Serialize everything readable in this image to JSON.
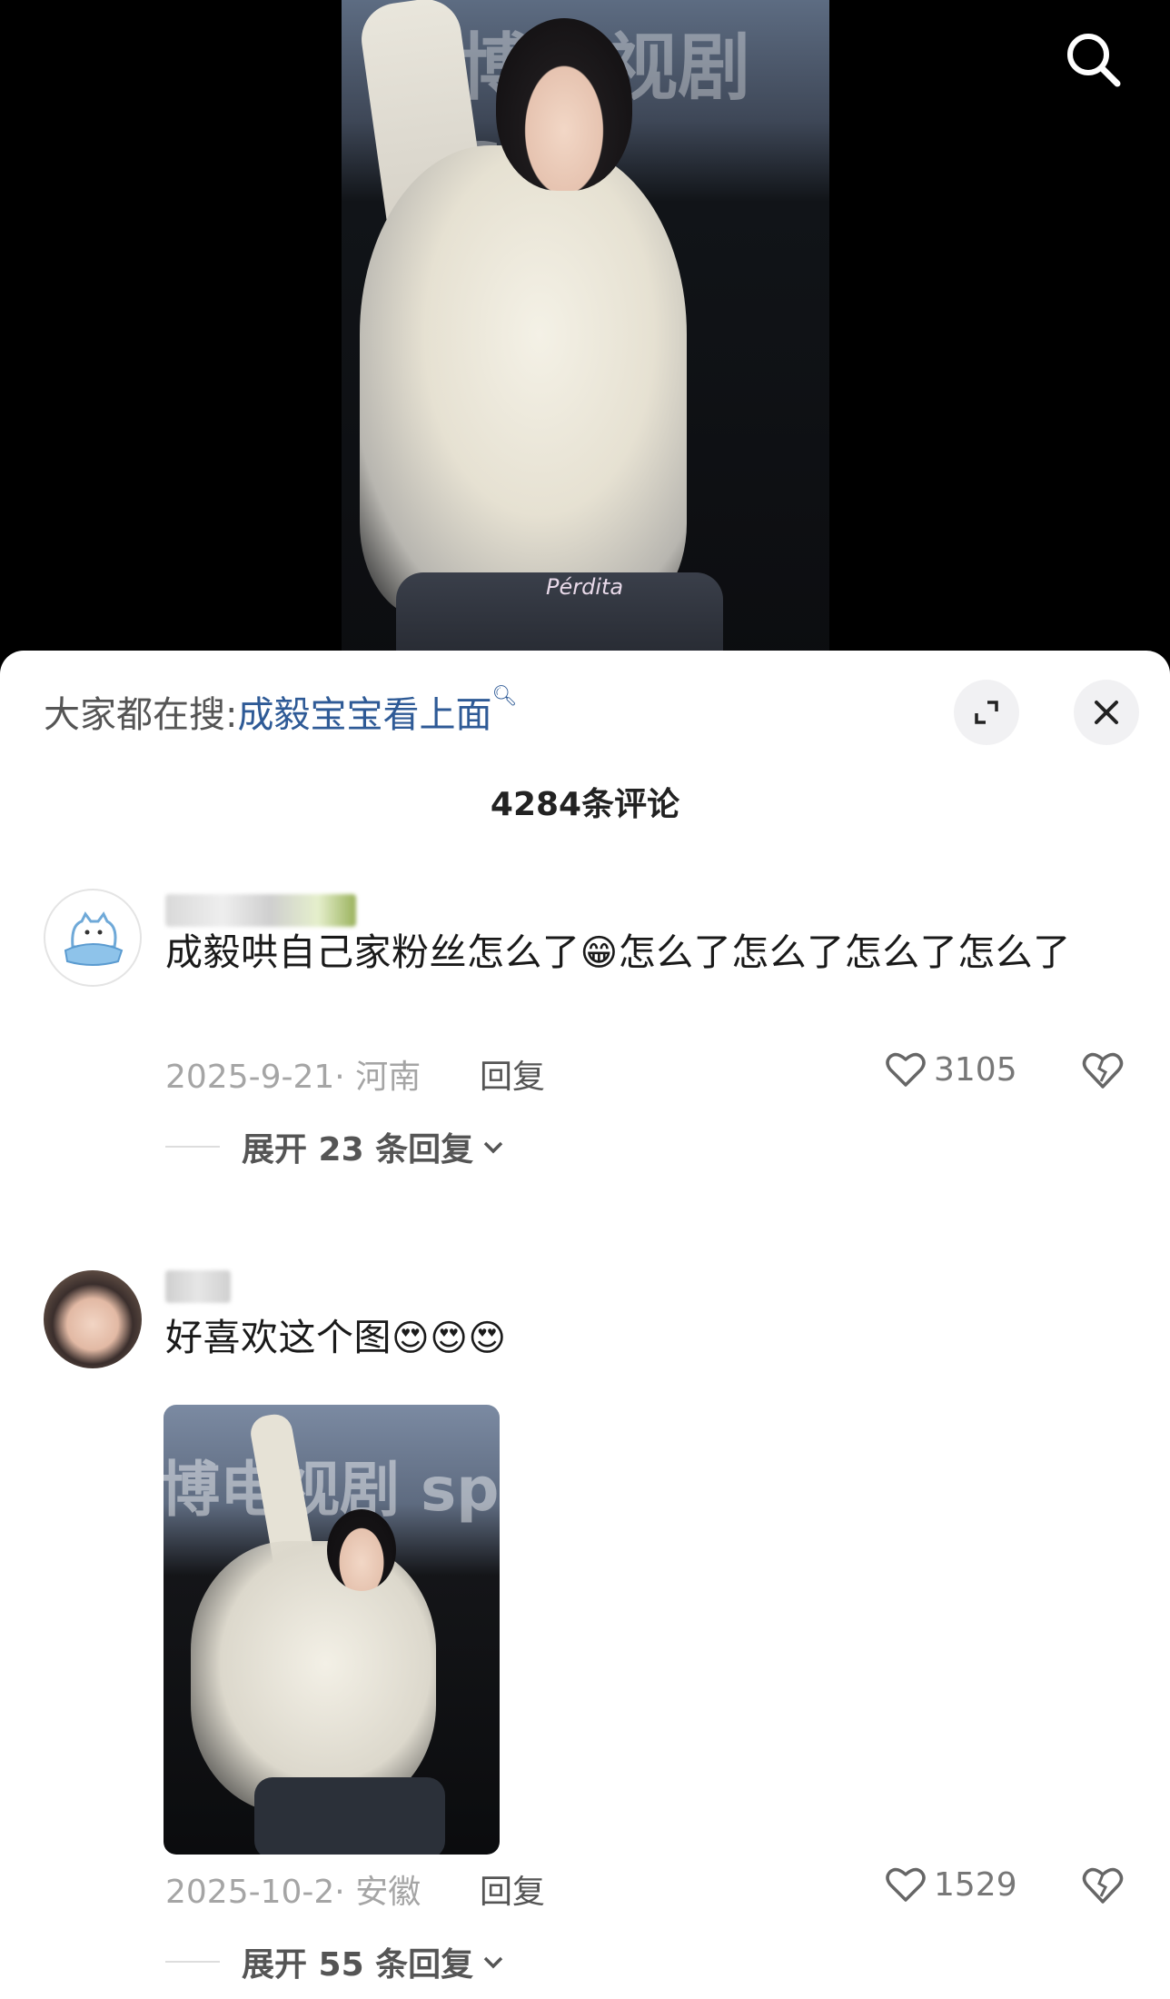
{
  "video": {
    "banner_text": "博电视剧 sp",
    "watermark": "Pérdita"
  },
  "header": {
    "search_prefix": "大家都在搜:",
    "search_keyword": "成毅宝宝看上面",
    "search_keyword_icon": "search-small-icon"
  },
  "comments_count_title": "4284条评论",
  "comments": [
    {
      "text_before_emoji": "成毅哄自己家粉丝怎么了",
      "emoji": "😁",
      "text_after_emoji": "怎么了怎么了怎么了怎么了",
      "date_location": "2025-9-21· 河南",
      "reply_label": "回复",
      "likes": "3105",
      "expand_label": "展开 23 条回复"
    },
    {
      "text": "好喜欢这个图",
      "emojis": "😍😍😍",
      "image_text": "博电视剧 sp",
      "date_location": "2025-10-2· 安徽",
      "reply_label": "回复",
      "likes": "1529",
      "expand_label": "展开 55 条回复"
    }
  ],
  "colors": {
    "keyword": "#2e5a96",
    "meta": "#a5a5a5"
  }
}
